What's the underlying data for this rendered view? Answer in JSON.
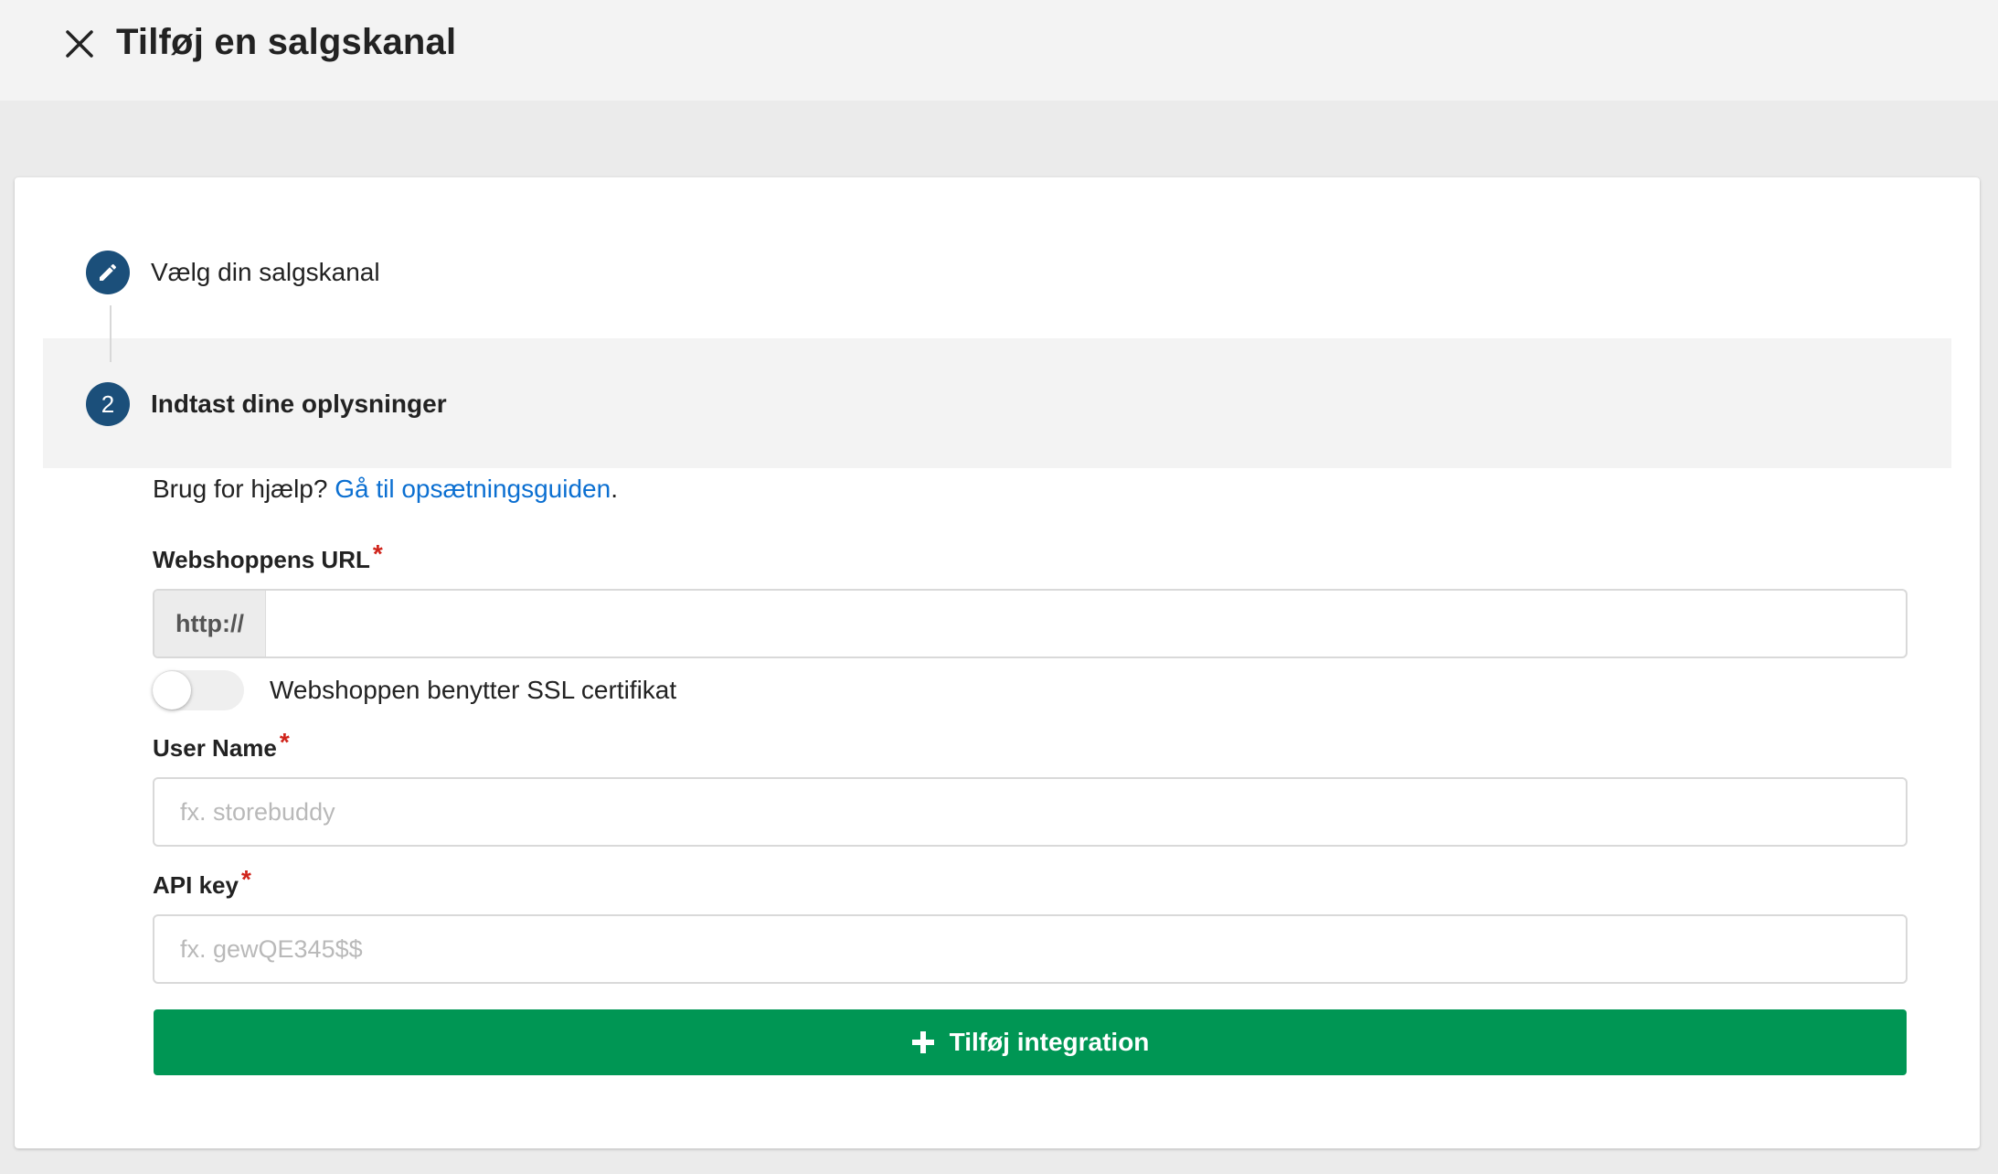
{
  "header": {
    "title": "Tilføj en salgskanal"
  },
  "steps": [
    {
      "icon": "pencil-icon",
      "label": "Vælg din salgskanal"
    },
    {
      "number": "2",
      "label": "Indtast dine oplysninger"
    }
  ],
  "help": {
    "prefix": "Brug for hjælp? ",
    "link_text": "Gå til opsætningsguiden",
    "suffix": "."
  },
  "form": {
    "url": {
      "label": "Webshoppens URL",
      "required_mark": "*",
      "prefix": "http://",
      "value": ""
    },
    "ssl_toggle": {
      "label": "Webshoppen benytter SSL certifikat",
      "on": false
    },
    "username": {
      "label": "User Name",
      "required_mark": "*",
      "placeholder": "fx. storebuddy",
      "value": ""
    },
    "api_key": {
      "label": "API key",
      "required_mark": "*",
      "placeholder": "fx. gewQE345$$",
      "value": ""
    },
    "submit_label": "Tilføj integration"
  },
  "colors": {
    "step_circle": "#1b4f7a",
    "link": "#0b6fd1",
    "required": "#d0241b",
    "submit": "#009654"
  }
}
